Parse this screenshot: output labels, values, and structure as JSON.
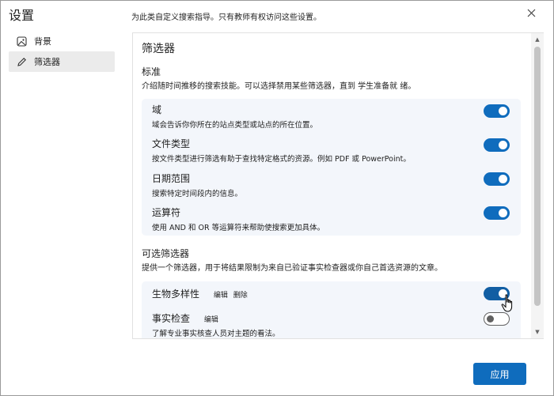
{
  "dialog": {
    "title": "设置",
    "subtitle": "为此类自定义搜索指导。只有教师有权访问这些设置。",
    "close_icon": "close-icon"
  },
  "sidebar": {
    "items": [
      {
        "label": "背景",
        "icon": "image-icon",
        "active": false
      },
      {
        "label": "筛选器",
        "icon": "pencil-icon",
        "active": true
      }
    ]
  },
  "content": {
    "section_title": "筛选器",
    "standard": {
      "title": "标准",
      "description": "介绍随时间推移的搜索技能。可以选择禁用某些筛选器，直到 学生准备就 绪。",
      "items": [
        {
          "title": "域",
          "description": "域会告诉你你所在的站点类型或站点的所在位置。",
          "enabled": true
        },
        {
          "title": "文件类型",
          "description": "按文件类型进行筛选有助于查找特定格式的资源。例如 PDF 或 PowerPoint。",
          "enabled": true
        },
        {
          "title": "日期范围",
          "description": "搜索特定时间段内的信息。",
          "enabled": true
        },
        {
          "title": "运算符",
          "description": "使用 AND 和 OR 等运算符来帮助使搜索更加具体。",
          "enabled": true
        }
      ]
    },
    "optional": {
      "title": "可选筛选器",
      "description": "提供一个筛选器，用于将结果限制为来自已验证事实检查器或你自己首选资源的文章。",
      "items": [
        {
          "title": "生物多样性",
          "edit_label": "编辑",
          "delete_label": "删除",
          "description": "",
          "enabled": true
        },
        {
          "title": "事实检查",
          "edit_label": "编辑",
          "description": "了解专业事实核查人员对主题的看法。",
          "enabled": false
        }
      ]
    }
  },
  "footer": {
    "apply_label": "应用"
  },
  "colors": {
    "accent": "#0f6cbd",
    "card": "#f3f6fb"
  }
}
